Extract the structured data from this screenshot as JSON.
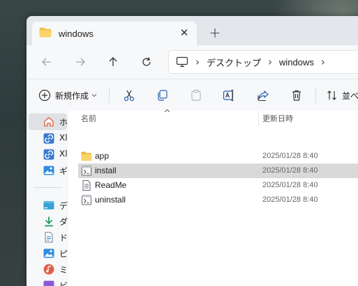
{
  "window": {
    "tab_title": "windows",
    "tab_close": "✕",
    "new_tab": "+"
  },
  "address": {
    "crumbs": [
      "デスクトップ",
      "windows"
    ],
    "separator": "›"
  },
  "commandbar": {
    "new_label": "新規作成",
    "sort_label": "並べ"
  },
  "sidebar": {
    "items": [
      {
        "label": "ホ",
        "icon": "home-icon",
        "selected": true
      },
      {
        "label": "Xl",
        "icon": "link-icon"
      },
      {
        "label": "Xl",
        "icon": "link-icon"
      },
      {
        "label": "ギ",
        "icon": "gallery-icon"
      },
      {
        "label": "デ",
        "icon": "desktop-icon"
      },
      {
        "label": "ダ",
        "icon": "download-icon"
      },
      {
        "label": "ド",
        "icon": "document-icon"
      },
      {
        "label": "ピ",
        "icon": "picture-icon"
      },
      {
        "label": "ミ",
        "icon": "music-icon"
      },
      {
        "label": "ビ",
        "icon": "video-icon"
      }
    ]
  },
  "columns": {
    "name": "名前",
    "modified": "更新日時"
  },
  "files": [
    {
      "name": "app",
      "date": "2025/01/28 8:40",
      "icon": "folder-icon",
      "selected": false
    },
    {
      "name": "install",
      "date": "2025/01/28 8:40",
      "icon": "script-icon",
      "selected": true
    },
    {
      "name": "ReadMe",
      "date": "2025/01/28 8:40",
      "icon": "text-file-icon",
      "selected": false
    },
    {
      "name": "uninstall",
      "date": "2025/01/28 8:40",
      "icon": "script-icon",
      "selected": false
    }
  ],
  "colors": {
    "accent": "#0067c0",
    "folder": "#f5c64f",
    "selection": "#d9d9d9"
  }
}
